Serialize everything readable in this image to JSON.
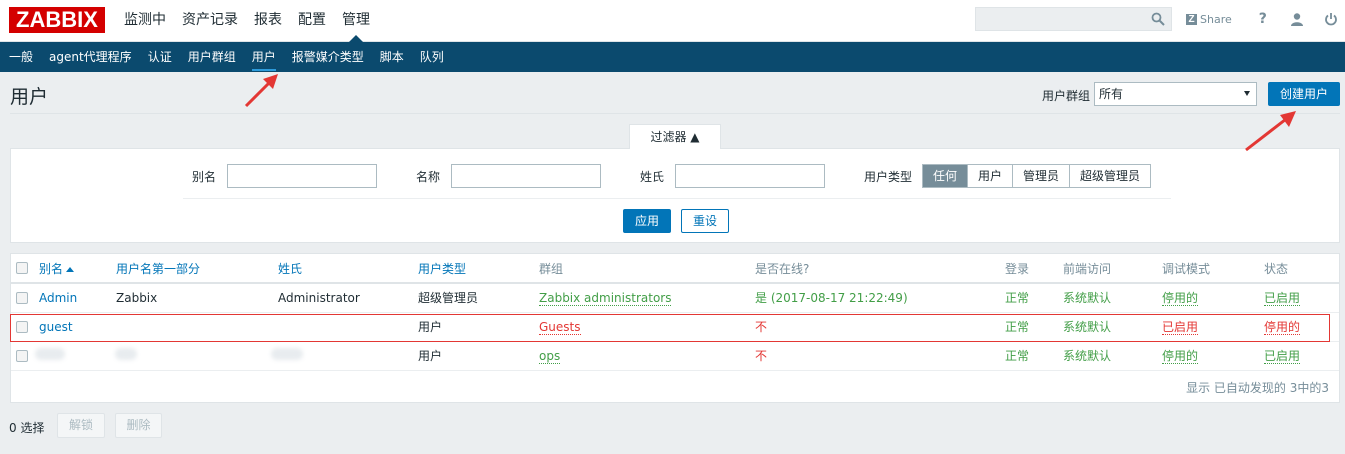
{
  "logo": "ZABBIX",
  "main_menu": [
    "监测中",
    "资产记录",
    "报表",
    "配置",
    "管理"
  ],
  "share_label": "Share",
  "help_label": "?",
  "sub_menu": [
    "一般",
    "agent代理程序",
    "认证",
    "用户群组",
    "用户",
    "报警媒介类型",
    "脚本",
    "队列"
  ],
  "page_title": "用户",
  "user_group_label": "用户群组",
  "user_group_value": "所有",
  "create_user_label": "创建用户",
  "filter": {
    "tab_label": "过滤器 ▲",
    "alias_label": "别名",
    "name_label": "名称",
    "surname_label": "姓氏",
    "user_type_label": "用户类型",
    "user_type_options": [
      "任何",
      "用户",
      "管理员",
      "超级管理员"
    ],
    "user_type_selected": "任何",
    "apply_label": "应用",
    "reset_label": "重设"
  },
  "table": {
    "headers": [
      "别名",
      "用户名第一部分",
      "姓氏",
      "用户类型",
      "群组",
      "是否在线?",
      "登录",
      "前端访问",
      "调试模式",
      "状态"
    ],
    "rows": [
      {
        "alias": "Admin",
        "name": "Zabbix",
        "surname": "Administrator",
        "type": "超级管理员",
        "group": "Zabbix administrators",
        "online": "是 (2017-08-17 21:22:49)",
        "login": "正常",
        "frontend": "系统默认",
        "debug": "停用的",
        "status": "已启用"
      },
      {
        "alias": "guest",
        "name": "",
        "surname": "",
        "type": "用户",
        "group": "Guests",
        "online": "不",
        "login": "正常",
        "frontend": "系统默认",
        "debug": "已启用",
        "status": "停用的"
      },
      {
        "alias": "",
        "name": "",
        "surname": "",
        "type": "用户",
        "group": "ops",
        "online": "不",
        "login": "正常",
        "frontend": "系统默认",
        "debug": "停用的",
        "status": "已启用"
      }
    ],
    "footer": "显示 已自动发现的 3中的3"
  },
  "selected_count": "0 选择",
  "unlock_label": "解锁",
  "delete_label": "删除",
  "colors": {
    "brand": "#d40000",
    "nav": "#0b4a6e",
    "accent": "#0275b8",
    "green": "#429e47",
    "red": "#e33734"
  }
}
